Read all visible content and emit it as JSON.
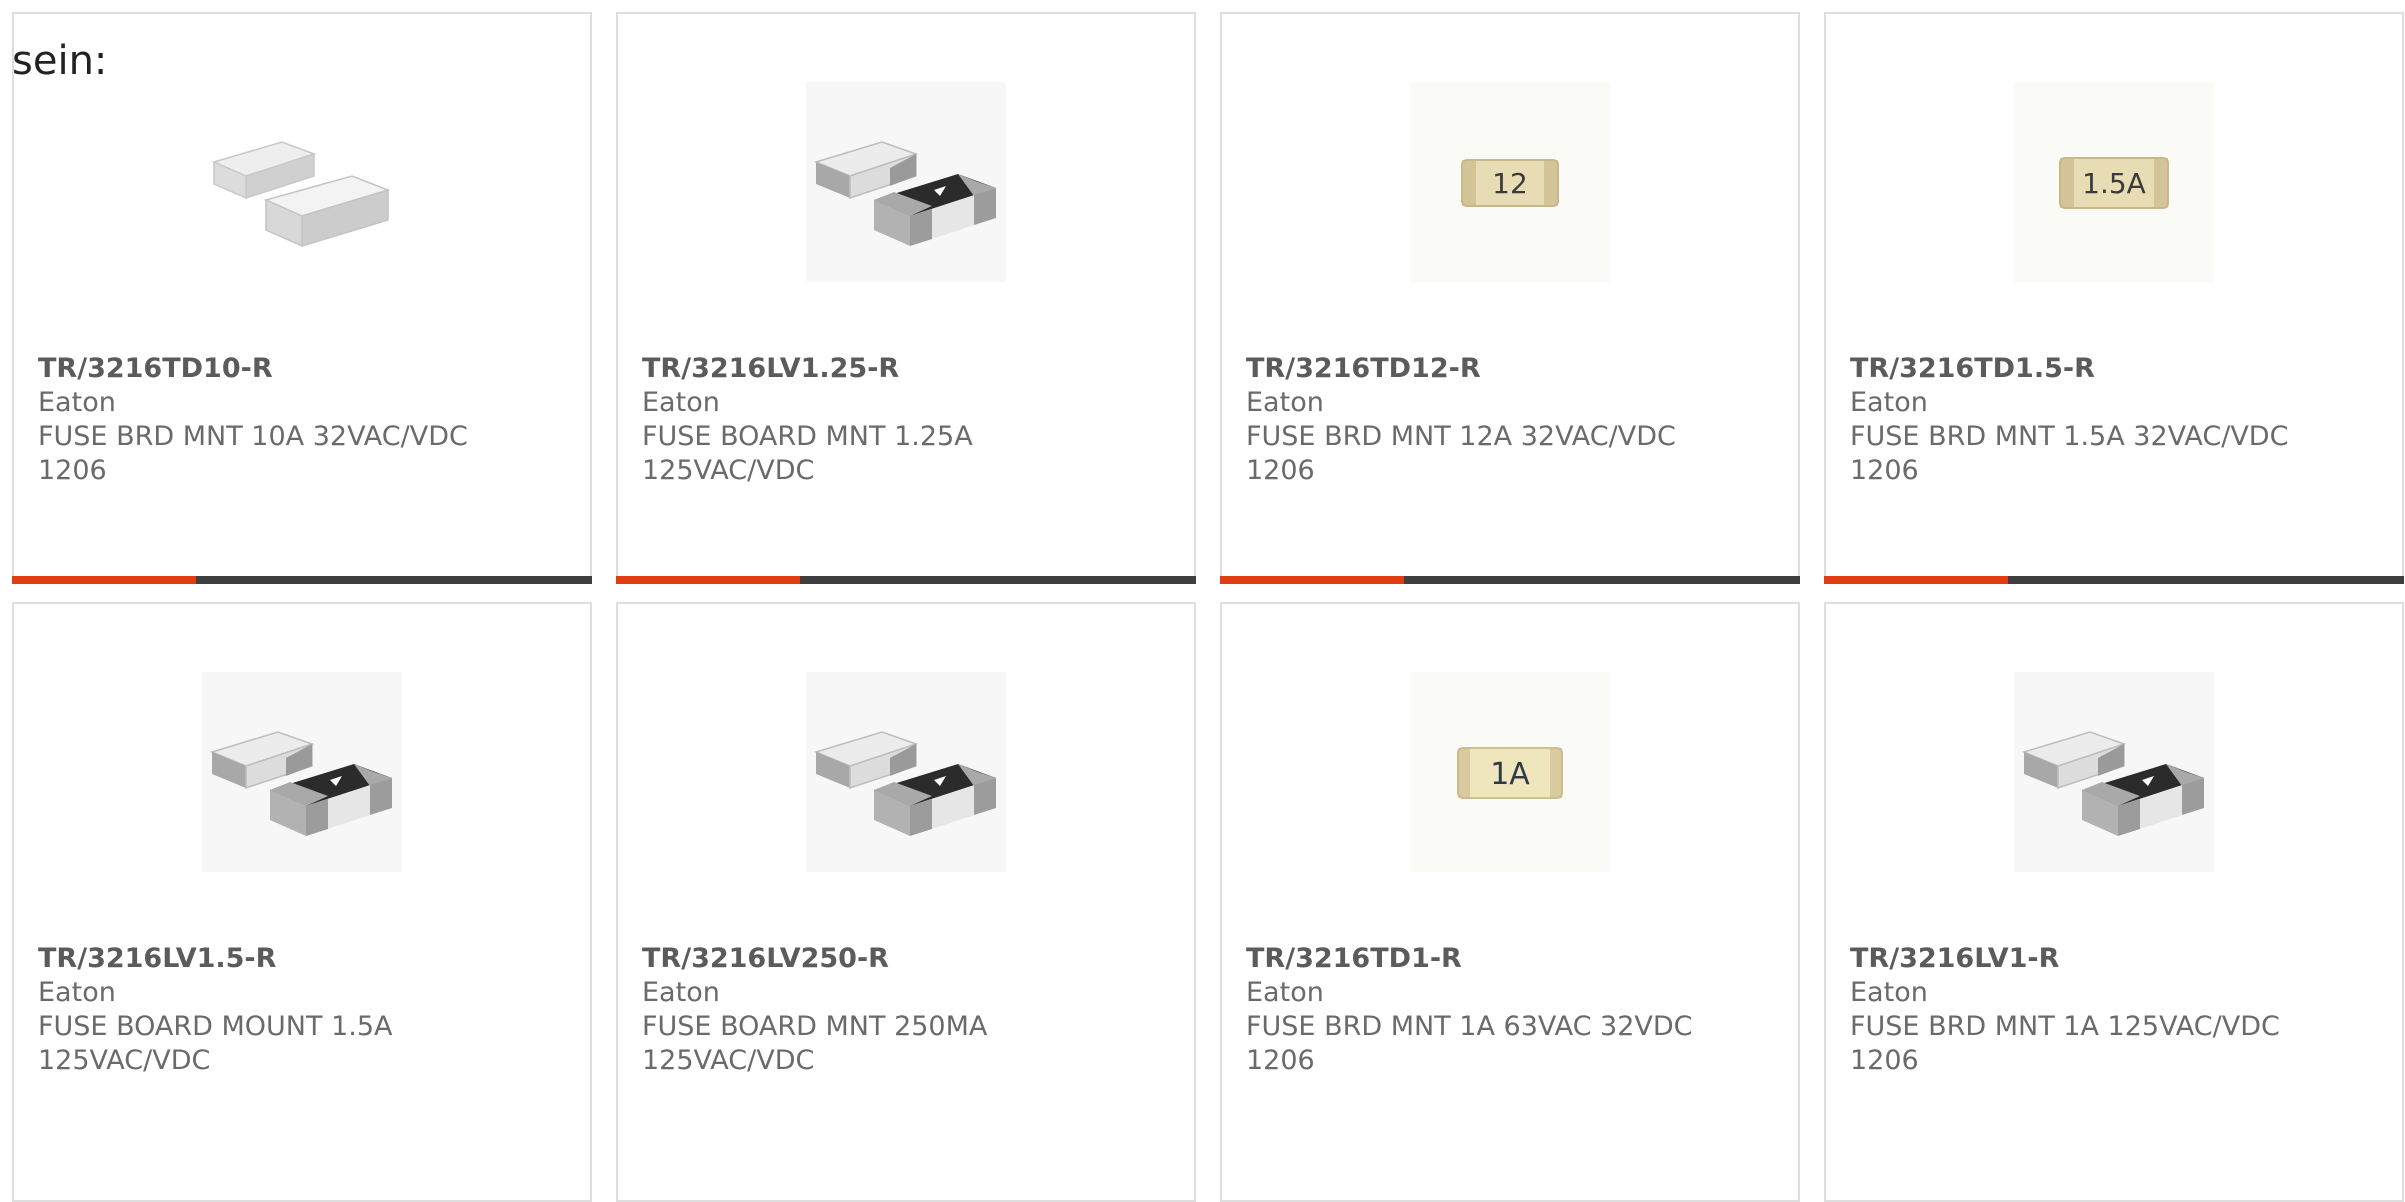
{
  "intro_text": "sein:",
  "colors": {
    "accent": "#e03c12",
    "bar_dark": "#3e3e3e",
    "border": "#dedede",
    "text": "#6a6a6a"
  },
  "products": [
    {
      "part": "TR/3216TD10-R",
      "maker": "Eaton",
      "desc1": "FUSE BRD MNT 10A 32VAC/VDC",
      "desc2": "1206",
      "image": "fuse-smd-white-icon"
    },
    {
      "part": "TR/3216LV1.25-R",
      "maker": "Eaton",
      "desc1": "FUSE BOARD MNT 1.25A",
      "desc2": "125VAC/VDC",
      "image": "fuse-smd-black-icon"
    },
    {
      "part": "TR/3216TD12-R",
      "maker": "Eaton",
      "desc1": "FUSE BRD MNT 12A 32VAC/VDC",
      "desc2": "1206",
      "image": "fuse-beige-12-icon",
      "marking": "12"
    },
    {
      "part": "TR/3216TD1.5-R",
      "maker": "Eaton",
      "desc1": "FUSE BRD MNT 1.5A 32VAC/VDC",
      "desc2": "1206",
      "image": "fuse-beige-1.5a-icon",
      "marking": "1.5A"
    },
    {
      "part": "TR/3216LV1.5-R",
      "maker": "Eaton",
      "desc1": "FUSE BOARD MOUNT 1.5A",
      "desc2": "125VAC/VDC",
      "image": "fuse-smd-black-icon"
    },
    {
      "part": "TR/3216LV250-R",
      "maker": "Eaton",
      "desc1": "FUSE BOARD MNT 250MA",
      "desc2": "125VAC/VDC",
      "image": "fuse-smd-black-icon"
    },
    {
      "part": "TR/3216TD1-R",
      "maker": "Eaton",
      "desc1": "FUSE BRD MNT 1A 63VAC 32VDC",
      "desc2": "1206",
      "image": "fuse-beige-1a-icon",
      "marking": "1A"
    },
    {
      "part": "TR/3216LV1-R",
      "maker": "Eaton",
      "desc1": "FUSE BRD MNT 1A 125VAC/VDC",
      "desc2": "1206",
      "image": "fuse-smd-black-icon"
    }
  ]
}
